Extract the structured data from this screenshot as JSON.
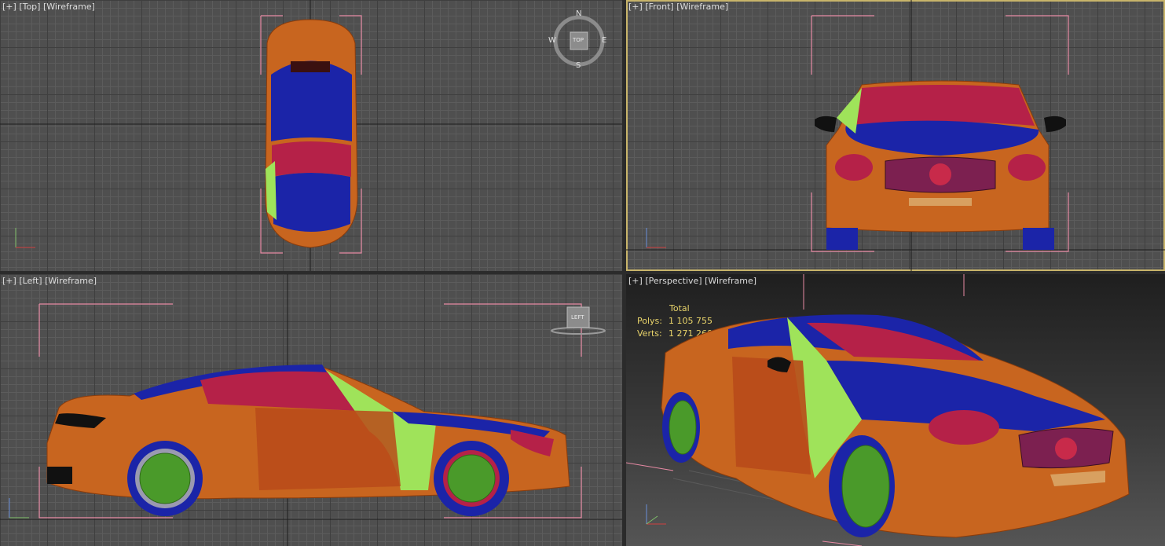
{
  "viewports": {
    "top": {
      "label": "[+] [Top] [Wireframe]",
      "plus": "[+]",
      "view": "[Top]",
      "mode": "[Wireframe]"
    },
    "front": {
      "label": "[+] [Front] [Wireframe]",
      "plus": "[+]",
      "view": "[Front]",
      "mode": "[Wireframe]"
    },
    "left": {
      "label": "[+] [Left] [Wireframe]",
      "plus": "[+]",
      "view": "[Left]",
      "mode": "[Wireframe]"
    },
    "perspective": {
      "label": "[+] [Perspective] [Wireframe]",
      "plus": "[+]",
      "view": "[Perspective]",
      "mode": "[Wireframe]"
    }
  },
  "compass": {
    "n": "N",
    "s": "S",
    "e": "E",
    "w": "W",
    "cube_top": "TOP",
    "cube_left": "LEFT"
  },
  "stats": {
    "header": "Total",
    "polys_label": "Polys:",
    "polys_value": "1 105 755",
    "verts_label": "Verts:",
    "verts_value": "1 271 260"
  },
  "axis": {
    "x": "x",
    "y": "y",
    "z": "z"
  },
  "colors": {
    "body": "#c8651f",
    "glass": "#1b24a8",
    "accent": "#9fe35a",
    "red": "#b52148",
    "grid": "#4f4f4f",
    "active_border": "#c8b46a"
  }
}
